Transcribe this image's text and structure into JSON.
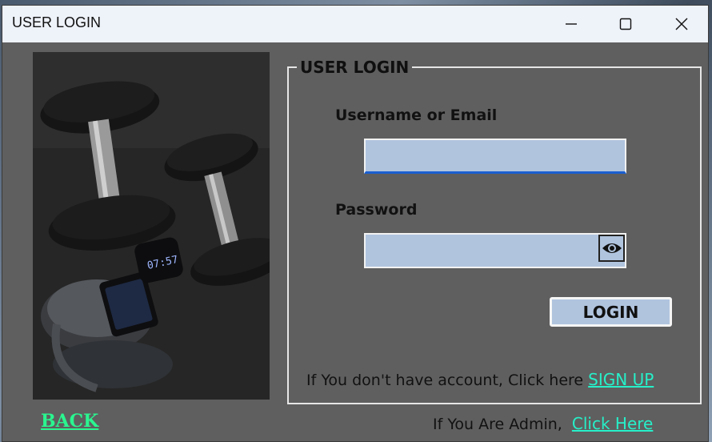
{
  "window": {
    "title": "USER LOGIN",
    "controls": {
      "minimize": "minimize-icon",
      "maximize": "maximize-icon",
      "close": "close-icon"
    }
  },
  "login_panel": {
    "legend": "USER LOGIN",
    "username_label": "Username or Email",
    "username_value": "",
    "password_label": "Password",
    "password_value": "",
    "show_password_icon": "eye-icon",
    "login_button": "LOGIN",
    "signup_prompt": "If You don't have account, Click here",
    "signup_link": "SIGN UP"
  },
  "footer": {
    "back_link": "BACK",
    "admin_prompt": "If You Are Admin,",
    "admin_link": "Click Here"
  },
  "colors": {
    "window_bg": "#5f5f5f",
    "input_bg": "#b0c4de",
    "link": "#26f0c9",
    "back_link": "#2af58f"
  },
  "photo": {
    "watch_time": "07:57"
  }
}
